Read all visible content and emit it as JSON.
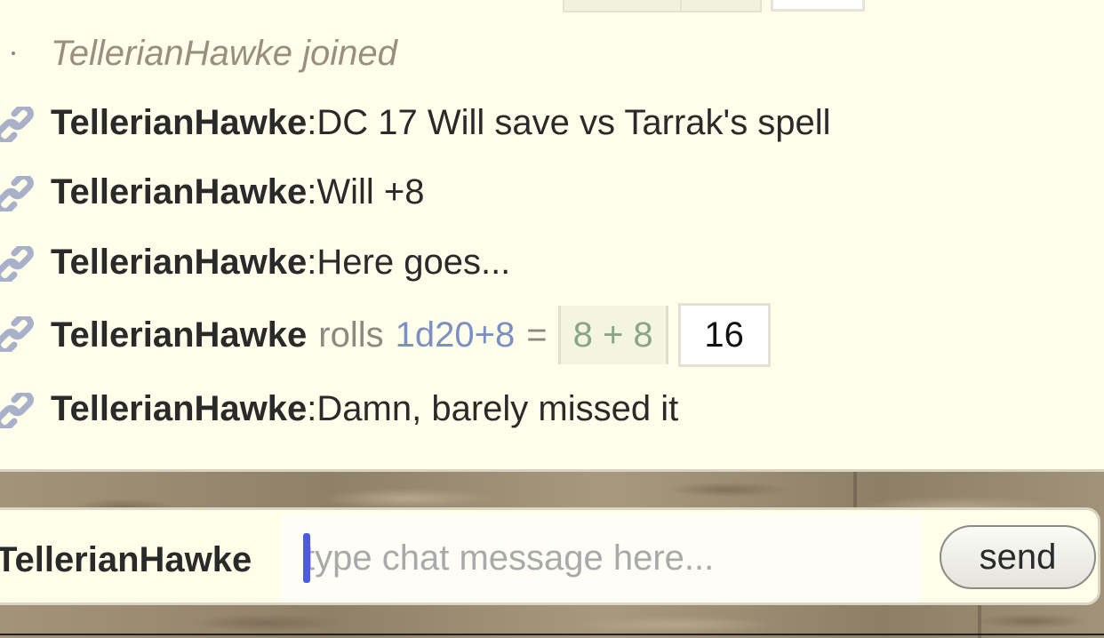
{
  "chat": {
    "system_line": "TellerianHawke joined",
    "messages": [
      {
        "sender": "TellerianHawke",
        "separator": ":",
        "text": " DC 17 Will save vs Tarrak's spell"
      },
      {
        "sender": "TellerianHawke",
        "separator": ":",
        "text": " Will +8"
      },
      {
        "sender": "TellerianHawke",
        "separator": ":",
        "text": " Here goes..."
      },
      {
        "sender": "TellerianHawke",
        "separator": ":",
        "text": " Damn, barely missed it"
      }
    ],
    "roll": {
      "sender": "TellerianHawke",
      "verb": "rolls",
      "formula": "1d20+8",
      "equals": "=",
      "parts": "8 + 8",
      "total": "16"
    }
  },
  "input_bar": {
    "player_name": "TellerianHawke",
    "placeholder": "type chat message here...",
    "value": "",
    "send_label": "send"
  },
  "colors": {
    "log_background": "#fefeea",
    "formula": "#7b8fc4",
    "roll_parts": "#8aa58a",
    "caret": "#4c5ce0"
  },
  "icons": {
    "message_link": "link-icon"
  }
}
